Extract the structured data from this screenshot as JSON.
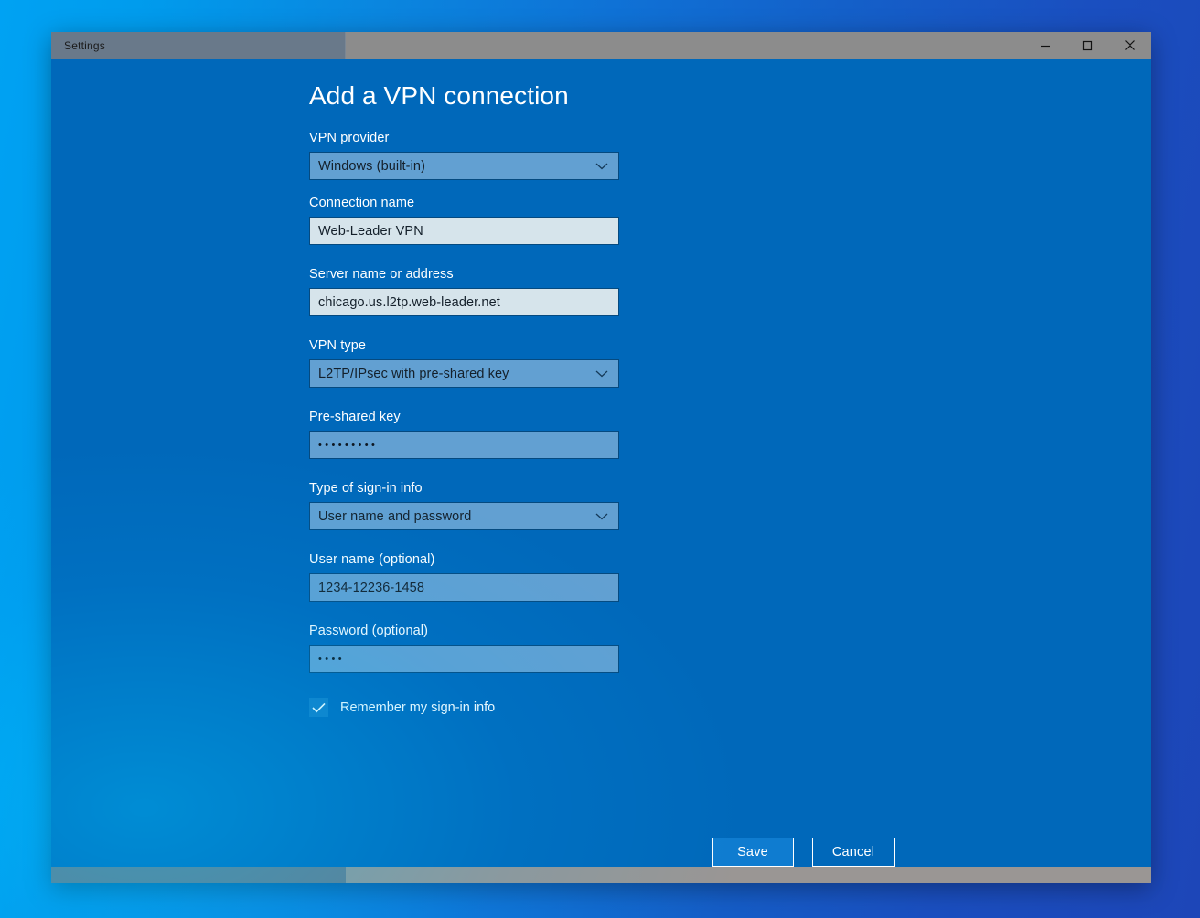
{
  "window": {
    "title": "Settings",
    "controls": {
      "minimize": "minimize-icon",
      "maximize": "maximize-icon",
      "close": "close-icon"
    }
  },
  "page": {
    "title": "Add a VPN connection"
  },
  "fields": [
    {
      "label": "VPN provider",
      "value": "Windows (built-in)",
      "kind": "dropdown",
      "name": "vpn-provider"
    },
    {
      "label": "Connection name",
      "value": "Web-Leader VPN",
      "kind": "textbox",
      "name": "connection-name"
    },
    {
      "label": "Server name or address",
      "value": "chicago.us.l2tp.web-leader.net",
      "kind": "textbox",
      "name": "server-name"
    },
    {
      "label": "VPN type",
      "value": "L2TP/IPsec with pre-shared key",
      "kind": "dropdown",
      "name": "vpn-type"
    },
    {
      "label": "Pre-shared key",
      "value": "•••••••••",
      "kind": "password",
      "name": "pre-shared-key"
    },
    {
      "label": "Type of sign-in info",
      "value": "User name and password",
      "kind": "dropdown",
      "name": "sign-in-type"
    },
    {
      "label": "User name (optional)",
      "value": "1234-12236-1458",
      "kind": "bluebox",
      "name": "user-name"
    },
    {
      "label": "Password (optional)",
      "value": "••••",
      "kind": "password",
      "name": "password"
    }
  ],
  "checkbox": {
    "label": "Remember my sign-in info",
    "checked": true
  },
  "buttons": {
    "save": "Save",
    "cancel": "Cancel"
  },
  "colors": {
    "accent": "#0068ba",
    "button_primary": "#0f7cd0",
    "textbox_bg": "#d6e4eb",
    "dropdown_bg": "#62a0d2",
    "titlebar_left": "#69798a",
    "titlebar_right": "#8c8c8c"
  }
}
